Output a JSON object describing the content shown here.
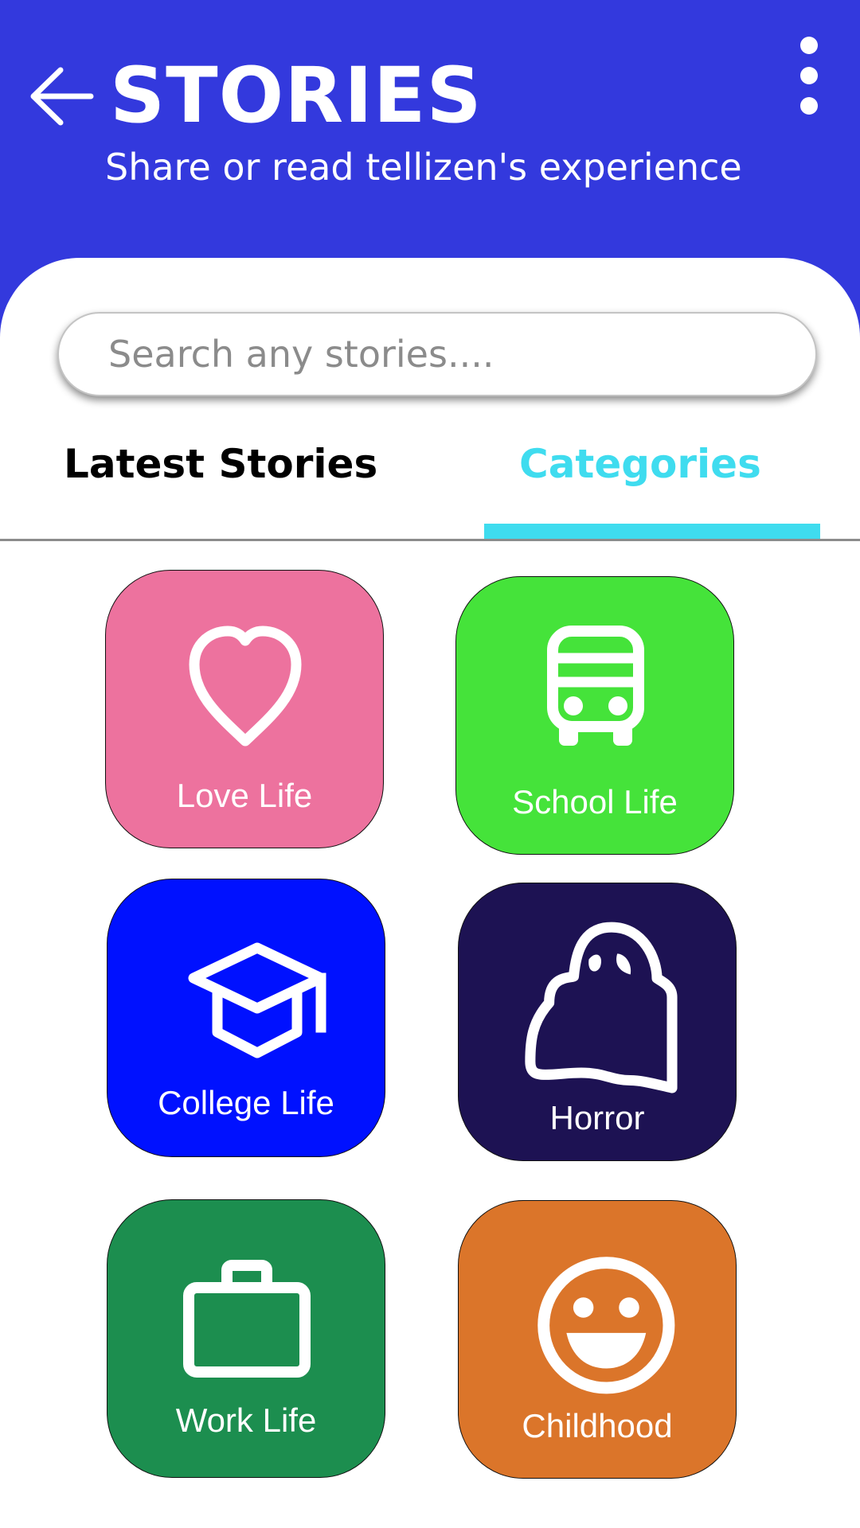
{
  "header": {
    "title": "STORIES",
    "subtitle": "Share or read tellizen's experience",
    "background_color": "#3339dd",
    "back_icon": "arrow-left-icon",
    "menu_icon": "vertical-dots-icon"
  },
  "search": {
    "value": "",
    "placeholder": "Search any stories...."
  },
  "tabs": [
    {
      "label": "Latest Stories",
      "active": false
    },
    {
      "label": "Categories",
      "active": true
    }
  ],
  "active_tab_color": "#3fdcef",
  "categories": [
    {
      "label": "Love Life",
      "icon": "heart-icon",
      "color": "#ed729e"
    },
    {
      "label": "School Life",
      "icon": "bus-icon",
      "color": "#45e33a"
    },
    {
      "label": "College Life",
      "icon": "graduation-cap-icon",
      "color": "#0011ff"
    },
    {
      "label": "Horror",
      "icon": "ghost-icon",
      "color": "#1d1253"
    },
    {
      "label": "Work Life",
      "icon": "briefcase-icon",
      "color": "#1c8e4f"
    },
    {
      "label": "Childhood",
      "icon": "smiley-face-icon",
      "color": "#db752a"
    }
  ]
}
